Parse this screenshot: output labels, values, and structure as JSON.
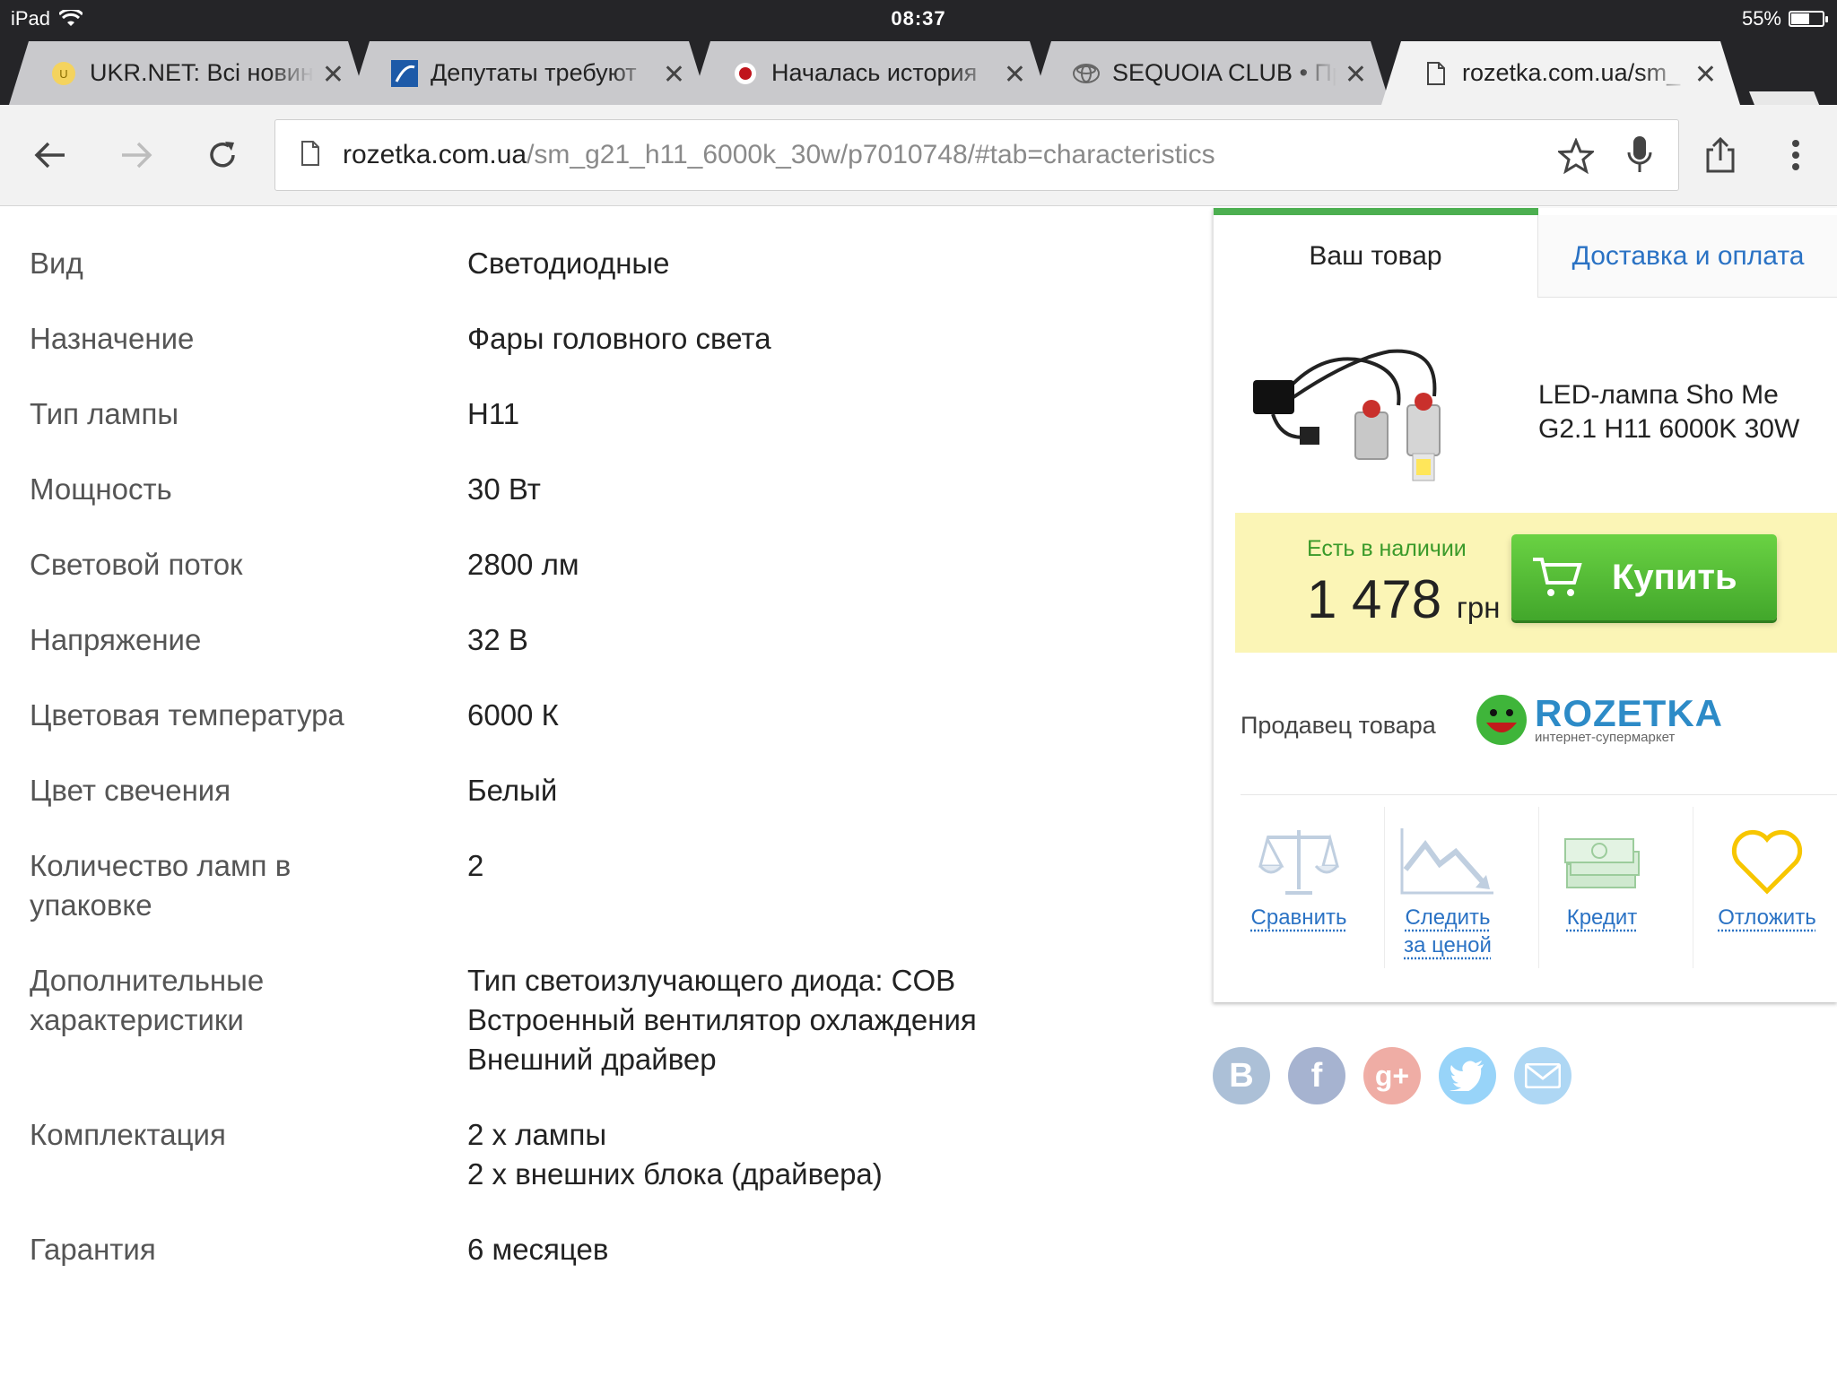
{
  "status_bar": {
    "device": "iPad",
    "time": "08:37",
    "battery": "55%"
  },
  "tabs": [
    {
      "title": "UKR.NET: Всі новини",
      "icon": "ukrnet-favicon"
    },
    {
      "title": "Депутаты требуют",
      "icon": "news-favicon"
    },
    {
      "title": "Началась история",
      "icon": "red-dot-favicon"
    },
    {
      "title": "SEQUOIA CLUB • Пр",
      "icon": "toyota-favicon"
    },
    {
      "title": "rozetka.com.ua/sm_",
      "icon": "page-icon",
      "active": true
    }
  ],
  "omnibox": {
    "domain": "rozetka.com.ua",
    "path": "/sm_g21_h11_6000k_30w/p7010748/#tab=characteristics"
  },
  "specs": [
    {
      "key": "Вид",
      "value": "Светодиодные"
    },
    {
      "key": "Назначение",
      "value": "Фары головного света"
    },
    {
      "key": "Тип лампы",
      "value": "H11"
    },
    {
      "key": "Мощность",
      "value": "30 Вт"
    },
    {
      "key": "Световой поток",
      "value": "2800 лм"
    },
    {
      "key": "Напряжение",
      "value": "32 В"
    },
    {
      "key": "Цветовая температура",
      "value": "6000 К"
    },
    {
      "key": "Цвет свечения",
      "value": "Белый"
    },
    {
      "key": "Количество ламп в\nупаковке",
      "value": "2"
    },
    {
      "key": "Дополнительные\nхарактеристики",
      "value": "Тип светоизлучающего диода: COB\nВстроенный вентилятор охлаждения\nВнешний драйвер"
    },
    {
      "key": "Комплектация",
      "value": "2 х лампы\n2 х внешних блока (драйвера)"
    },
    {
      "key": "Гарантия",
      "value": "6 месяцев"
    }
  ],
  "panel": {
    "tab_product": "Ваш товар",
    "tab_delivery": "Доставка и оплата",
    "product_name": "LED-лампа Sho Me G2.1 H11 6000K 30W",
    "stock": "Есть в наличии",
    "price": "1 478",
    "currency": "грн",
    "buy": "Купить",
    "seller_label": "Продавец товара",
    "seller_name": "ROZETKA",
    "seller_tagline": "интернет-супермаркет",
    "actions": {
      "compare": "Сравнить",
      "track_1": "Следить",
      "track_2": "за ценой",
      "credit": "Кредит",
      "wishlist": "Отложить"
    }
  },
  "colors": {
    "accent_green": "#4caf50",
    "link_blue": "#2a72c4",
    "buy_box": "#fbf5b6",
    "wishlist_heart": "#f7c600"
  },
  "social": [
    "vk-icon",
    "facebook-icon",
    "google-plus-icon",
    "twitter-icon",
    "mail-icon"
  ]
}
